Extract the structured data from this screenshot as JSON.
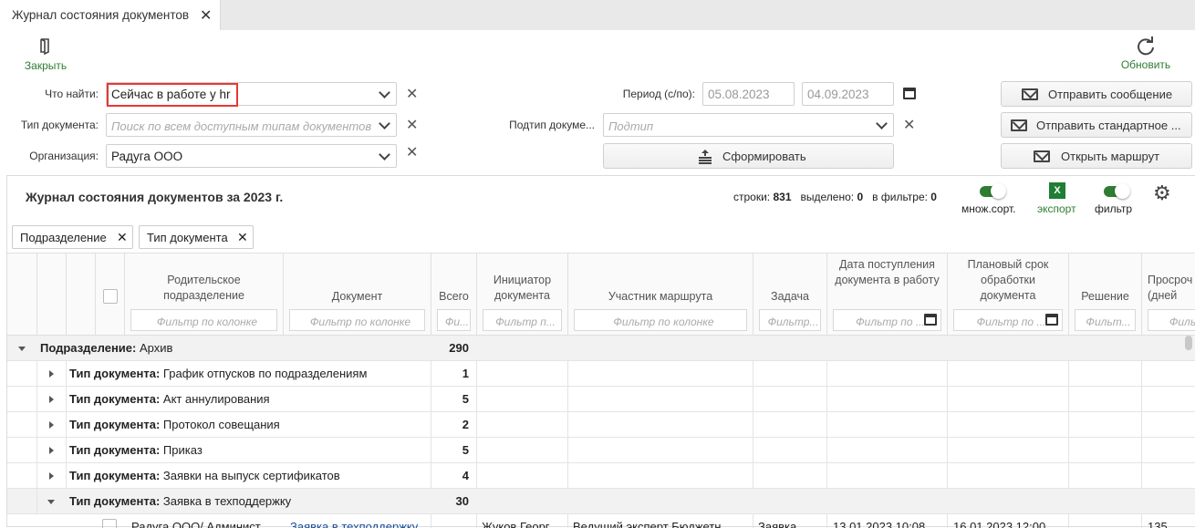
{
  "tab": {
    "title": "Журнал состояния документов"
  },
  "toolbar": {
    "close_label": "Закрыть",
    "refresh_label": "Обновить"
  },
  "filters": {
    "what_label": "Что найти:",
    "what_value": "Сейчас в работе у hr",
    "doctype_label": "Тип документа:",
    "doctype_placeholder": "Поиск по всем доступным типам документов",
    "org_label": "Организация:",
    "org_value": "Радуга ООО",
    "period_label": "Период (с/по):",
    "period_from": "05.08.2023",
    "period_to": "04.09.2023",
    "subtype_label": "Подтип докуме...",
    "subtype_placeholder": "Подтип",
    "build_label": "Сформировать"
  },
  "actions": {
    "send_message": "Отправить сообщение",
    "send_standard": "Отправить стандартное ...",
    "open_route": "Открыть маршрут"
  },
  "grid": {
    "title": "Журнал состояния документов за 2023 г.",
    "rows_label": "строки:",
    "rows_value": "831",
    "selected_label": "выделено:",
    "selected_value": "0",
    "infilter_label": "в фильтре:",
    "infilter_value": "0",
    "multisort_label": "множ.сорт.",
    "export_label": "экспорт",
    "filter_label": "фильтр",
    "group_chips": [
      "Подразделение",
      "Тип документа"
    ],
    "columns": [
      "Родительское подразделение",
      "Документ",
      "Всего",
      "Инициатор документа",
      "Участник маршрута",
      "Задача",
      "Дата поступления документа в работу",
      "Плановый срок обработки документа",
      "Решение",
      "Просроч (дней"
    ],
    "col_filters": [
      "Фильтр по колонке",
      "Фильтр по колонке",
      "Фи...",
      "Фильтр п...",
      "Фильтр по колонке",
      "Фильтр...",
      "Фильтр по ...",
      "Фильтр по ...",
      "Фильт...",
      "Фильт"
    ],
    "group_row": {
      "label": "Подразделение:",
      "value": "Архив",
      "count": "290"
    },
    "sub_label": "Тип документа:",
    "sub_rows": [
      {
        "value": "График отпусков по подразделениям",
        "count": "1"
      },
      {
        "value": "Акт аннулирования",
        "count": "5"
      },
      {
        "value": "Протокол совещания",
        "count": "2"
      },
      {
        "value": "Приказ",
        "count": "5"
      },
      {
        "value": "Заявки на выпуск сертификатов",
        "count": "4"
      },
      {
        "value": "Заявка в техподдержку",
        "count": "30"
      }
    ],
    "partial_row": [
      "Радуга ООО/ Админист",
      "Заявка в техподдержку",
      "Жуков Георг",
      "Ведущий эксперт Бюджетн",
      "Заявка",
      "13.01.2023 10:08",
      "16.01.2023 12:00",
      "135"
    ]
  }
}
